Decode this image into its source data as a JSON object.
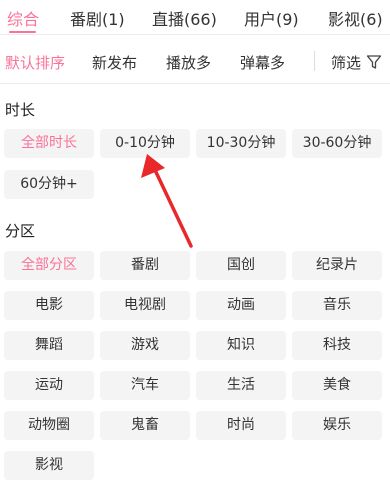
{
  "tabs": [
    {
      "label": "综合",
      "active": true
    },
    {
      "label": "番剧(1)",
      "active": false
    },
    {
      "label": "直播(66)",
      "active": false
    },
    {
      "label": "用户(9)",
      "active": false
    },
    {
      "label": "影视(6)",
      "active": false
    }
  ],
  "sort": {
    "options": [
      {
        "label": "默认排序",
        "active": true
      },
      {
        "label": "新发布",
        "active": false
      },
      {
        "label": "播放多",
        "active": false
      },
      {
        "label": "弹幕多",
        "active": false
      }
    ],
    "filter_label": "筛选",
    "filter_icon": "funnel-icon"
  },
  "duration": {
    "title": "时长",
    "options": [
      {
        "label": "全部时长",
        "active": true
      },
      {
        "label": "0-10分钟",
        "active": false
      },
      {
        "label": "10-30分钟",
        "active": false
      },
      {
        "label": "30-60分钟",
        "active": false
      },
      {
        "label": "60分钟+",
        "active": false
      }
    ]
  },
  "category": {
    "title": "分区",
    "options": [
      {
        "label": "全部分区",
        "active": true
      },
      {
        "label": "番剧",
        "active": false
      },
      {
        "label": "国创",
        "active": false
      },
      {
        "label": "纪录片",
        "active": false
      },
      {
        "label": "电影",
        "active": false
      },
      {
        "label": "电视剧",
        "active": false
      },
      {
        "label": "动画",
        "active": false
      },
      {
        "label": "音乐",
        "active": false
      },
      {
        "label": "舞蹈",
        "active": false
      },
      {
        "label": "游戏",
        "active": false
      },
      {
        "label": "知识",
        "active": false
      },
      {
        "label": "科技",
        "active": false
      },
      {
        "label": "运动",
        "active": false
      },
      {
        "label": "汽车",
        "active": false
      },
      {
        "label": "生活",
        "active": false
      },
      {
        "label": "美食",
        "active": false
      },
      {
        "label": "动物圈",
        "active": false
      },
      {
        "label": "鬼畜",
        "active": false
      },
      {
        "label": "时尚",
        "active": false
      },
      {
        "label": "娱乐",
        "active": false
      },
      {
        "label": "影视",
        "active": false
      }
    ]
  },
  "colors": {
    "accent": "#fb7299",
    "chip_background": "#f4f4f4",
    "annotation_arrow": "#e8282b"
  }
}
